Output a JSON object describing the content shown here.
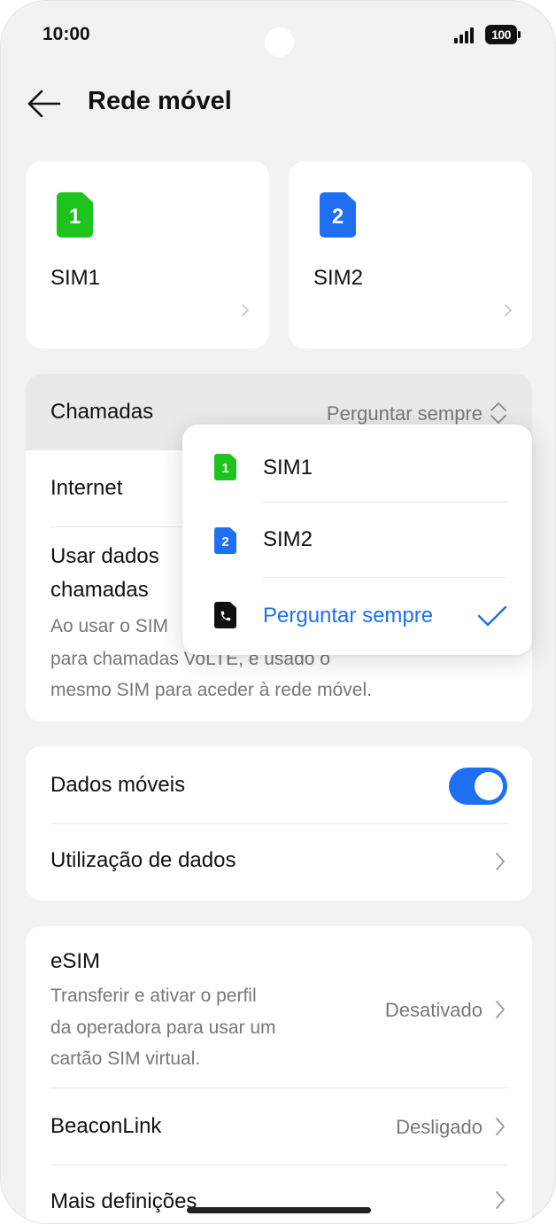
{
  "status_bar": {
    "time": "10:00",
    "battery": "100"
  },
  "header": {
    "title": "Rede móvel"
  },
  "sim_cards": [
    {
      "badge": "1",
      "name": "SIM1",
      "color": "#1ec31e"
    },
    {
      "badge": "2",
      "name": "SIM2",
      "color": "#1f6ff2"
    }
  ],
  "calls_section": {
    "chamadas": {
      "label": "Chamadas",
      "value": "Perguntar sempre"
    },
    "internet": {
      "label": "Internet"
    },
    "usar_dados": {
      "label_line1": "Usar dados",
      "label_line2": "chamadas",
      "desc_line1": "Ao usar o SIM",
      "desc_line2": "para chamadas VoLTE, é usado o",
      "desc_line3": "mesmo SIM para aceder à rede móvel."
    }
  },
  "data_section": {
    "dados_moveis": {
      "label": "Dados móveis",
      "enabled": true
    },
    "utilizacao": {
      "label": "Utilização de dados"
    }
  },
  "other_section": {
    "esim": {
      "label": "eSIM",
      "desc_line1": "Transferir e ativar o perfil",
      "desc_line2": "da operadora para usar um",
      "desc_line3": "cartão SIM virtual.",
      "value": "Desativado"
    },
    "beaconlink": {
      "label": "BeaconLink",
      "value": "Desligado"
    },
    "mais": {
      "label": "Mais definições"
    }
  },
  "popup_menu": {
    "items": [
      {
        "icon": "1",
        "label": "SIM1",
        "color": "#1ec31e",
        "selected": false
      },
      {
        "icon": "2",
        "label": "SIM2",
        "color": "#1f6ff2",
        "selected": false
      },
      {
        "icon": "phone",
        "label": "Perguntar sempre",
        "color": "#111111",
        "selected": true
      }
    ]
  },
  "colors": {
    "accent": "#1f6ff2",
    "sim1": "#1ec31e",
    "sim2": "#1f6ff2"
  }
}
